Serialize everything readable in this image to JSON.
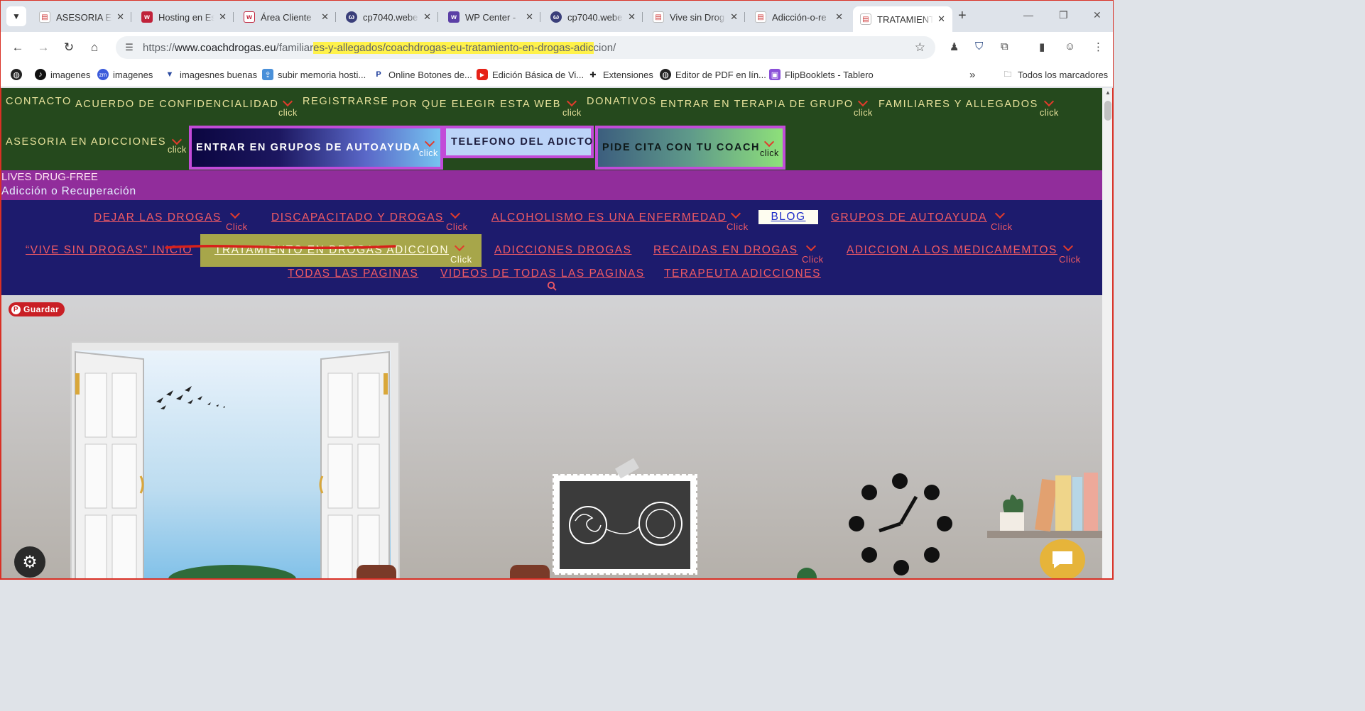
{
  "browser": {
    "tabs": [
      {
        "label": "ASESORIA EN",
        "favicon": "page-icon"
      },
      {
        "label": "Hosting en Es",
        "favicon": "webempresa-icon"
      },
      {
        "label": "Área Cliente",
        "favicon": "webempresa-icon"
      },
      {
        "label": "cp7040.webe",
        "favicon": "cpanel-icon"
      },
      {
        "label": "WP Center -",
        "favicon": "wp-icon"
      },
      {
        "label": "cp7040.webe",
        "favicon": "cpanel-icon"
      },
      {
        "label": "Vive sin Drog",
        "favicon": "page-icon"
      },
      {
        "label": "Adicción-o-re",
        "favicon": "page-icon"
      },
      {
        "label": "TRATAMIENTO",
        "favicon": "page-icon",
        "active": true
      }
    ],
    "url": {
      "scheme": "https://",
      "domain": "www.coachdrogas.eu",
      "path_plain": "/familiar",
      "path_highlight": "es-y-allegados/coachdrogas-eu-tratamiento-en-drogas-adic",
      "path_end": "cion/"
    },
    "bookmarks": [
      "imagenes",
      "imagenes",
      "imagesnes buenas",
      "subir memoria hosti...",
      "Online Botones de...",
      "Edición Básica de Vi...",
      "Extensiones",
      "Editor de PDF en lín...",
      "FlipBooklets - Tablero"
    ],
    "all_bookmarks": "Todos los marcadores"
  },
  "topnav": {
    "contacto": "CONTACTO",
    "acuerdo": "ACUERDO DE CONFIDENCIALIDAD",
    "registrarse": "REGISTRARSE",
    "por_que": "POR QUE ELEGIR ESTA WEB",
    "donativos": "DONATIVOS",
    "terapia": "ENTRAR EN TERAPIA DE GRUPO",
    "familiares": "FAMILIARES Y ALLEGADOS",
    "asesoria": "ASESORIA EN ADICCIONES",
    "grupos": "ENTRAR EN GRUPOS DE AUTOAYUDA",
    "telefono": "TELEFONO DEL ADICTO",
    "cita": "PIDE CITA CON TU COACH",
    "click": "click"
  },
  "site": {
    "line1": "LIVES DRUG-FREE",
    "line2": "Adicción o Recuperación"
  },
  "menu2": {
    "dejar": "DEJAR LAS DROGAS",
    "discapacitado": "DISCAPACITADO Y DROGAS",
    "alcoholismo": "ALCOHOLISMO ES UNA ENFERMEDAD",
    "blog": "BLOG",
    "grupos": "GRUPOS DE AUTOAYUDA",
    "vive": "“VIVE SIN DROGAS” INICIO",
    "tratamiento": "TRATAMIENTO EN DROGAS ADICCION",
    "adicciones": "ADICCIONES DROGAS",
    "recaidas": "RECAIDAS EN DROGAS",
    "medicamentos": "ADICCION A LOS MEDICAMEMTOS",
    "todas": "TODAS LAS PAGINAS",
    "videos": "VIDEOS DE TODAS LAS PAGINAS",
    "terapeuta": "TERAPEUTA ADICCIONES",
    "click": "Click"
  },
  "hero": {
    "pin_label": "Guardar"
  },
  "colors": {
    "topnav_bg": "#25491d",
    "topnav_text": "#e9e39c",
    "purple_bar": "#912d9b",
    "menu2_bg": "#1d1b6d",
    "menu2_link": "#f15a64",
    "accent_red": "#e23b2c"
  }
}
